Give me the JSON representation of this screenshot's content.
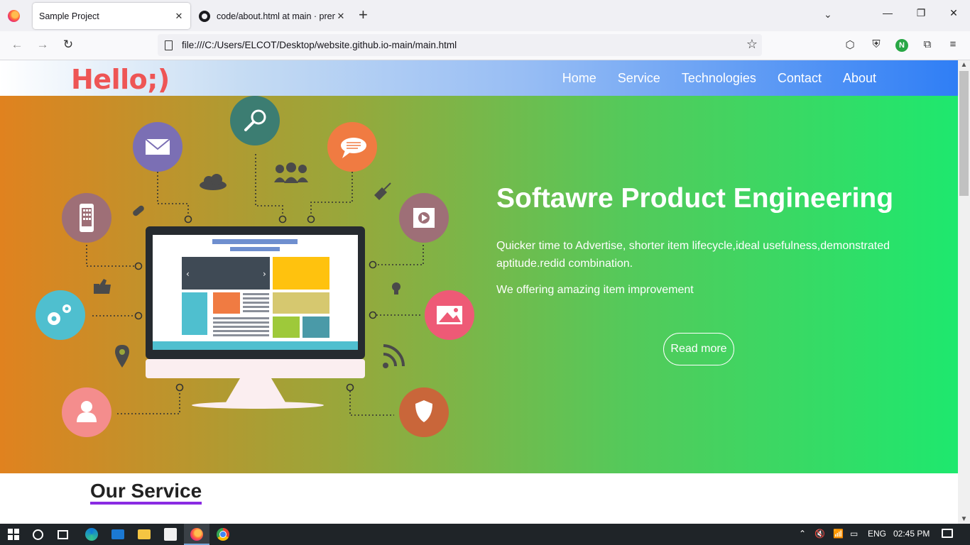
{
  "browser": {
    "tabs": [
      {
        "title": "Sample Project",
        "close": "✕",
        "active": true
      },
      {
        "title": "code/about.html at main · prem",
        "close": "✕",
        "active": false
      }
    ],
    "new_tab": "+",
    "tab_list": "⌄",
    "window_controls": {
      "minimize": "—",
      "restore": "❐",
      "close": "✕"
    },
    "url": "file:///C:/Users/ELCOT/Desktop/website.github.io-main/main.html",
    "nav": {
      "back": "←",
      "forward": "→",
      "reload": "↻"
    },
    "bookmark_star": "☆",
    "toolbar": {
      "pocket": "⬡",
      "shield": "⛨",
      "extension_n": "N",
      "extensions": "⧉",
      "menu": "≡"
    }
  },
  "site": {
    "logo": "Hello;)",
    "nav": [
      "Home",
      "Service",
      "Technologies",
      "Contact",
      "About"
    ],
    "hero": {
      "title": "Softawre Product Engineering",
      "paragraph1": "Quicker time to Advertise, shorter item lifecycle,ideal usefulness,demonstrated aptitude.redid combination.",
      "paragraph2": "We offering amazing item improvement",
      "button": "Read more"
    },
    "section_title": "Our Service"
  },
  "illustration": {
    "icons": [
      "mail-icon",
      "search-icon",
      "chat-icon",
      "phone-icon",
      "video-icon",
      "gears-icon",
      "image-icon",
      "user-icon",
      "shield-icon",
      "cloud-icon",
      "people-icon",
      "satellite-icon",
      "link-icon",
      "thumbs-up-icon",
      "location-pin-icon",
      "bulb-icon",
      "rss-icon",
      "monitor-icon"
    ],
    "colors": {
      "mail": "#7b6fb4",
      "search": "#3c7d72",
      "chat": "#f07b42",
      "phone": "#9e6f77",
      "video": "#9e6f77",
      "gears": "#4fbfcf",
      "image": "#ee5a76",
      "user": "#f48d8d",
      "shield": "#c9663a"
    }
  },
  "taskbar": {
    "tray": {
      "chevron": "⌃",
      "volume": "🔇",
      "wifi": "📶",
      "battery": "▭",
      "language": "ENG",
      "time": "02:45 PM"
    }
  },
  "colors": {
    "logo": "#ee5555",
    "section_underline": "#8a2be2",
    "hero_gradient": [
      "#e0821f",
      "#9aa63a",
      "#55c95a",
      "#1ee86e"
    ],
    "header_gradient": [
      "#ffffff",
      "#c6dcf3",
      "#97bdf4",
      "#2f7ef5"
    ]
  }
}
